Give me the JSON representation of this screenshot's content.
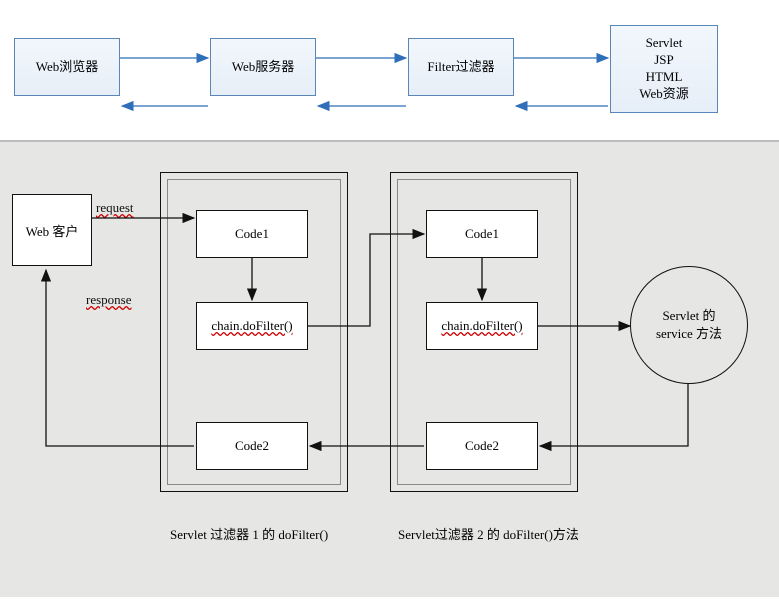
{
  "top": {
    "boxes": {
      "browser": "Web浏览器",
      "server": "Web服务器",
      "filter": "Filter过滤器",
      "resource_l1": "Servlet",
      "resource_l2": "JSP",
      "resource_l3": "HTML",
      "resource_l4": "Web资源"
    }
  },
  "bottom": {
    "client": "Web 客户",
    "request_label": "request",
    "response_label": "response",
    "filter1": {
      "code1": "Code1",
      "chain": "chain.doFilter()",
      "code2": "Code2",
      "caption": "Servlet 过滤器 1 的 doFilter()"
    },
    "filter2": {
      "code1": "Code1",
      "chain": "chain.doFilter()",
      "code2": "Code2",
      "caption": "Servlet过滤器 2 的 doFilter()方法"
    },
    "servlet_l1": "Servlet 的",
    "servlet_l2": "service 方法"
  }
}
